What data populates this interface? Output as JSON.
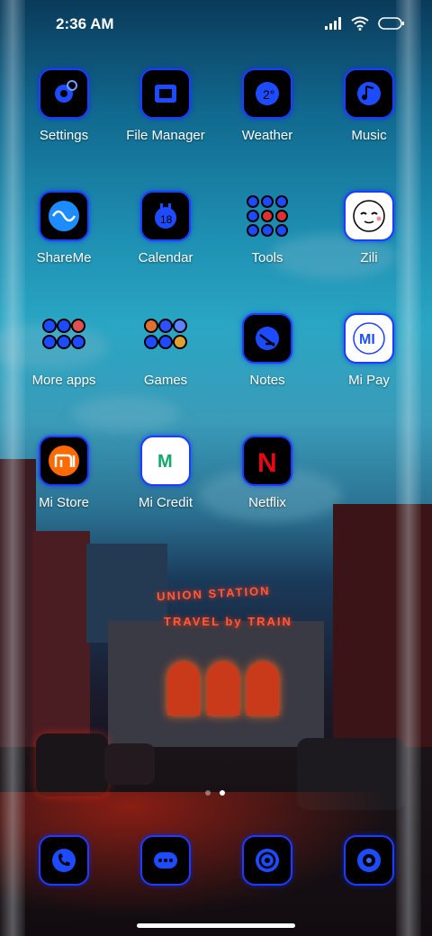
{
  "status_bar": {
    "time": "2:36 AM",
    "icons": [
      "signal-icon",
      "wifi-icon",
      "battery-icon"
    ]
  },
  "apps": [
    {
      "label": "Settings",
      "icon": "settings-icon"
    },
    {
      "label": "File Manager",
      "icon": "file-manager-icon"
    },
    {
      "label": "Weather",
      "icon": "weather-icon"
    },
    {
      "label": "Music",
      "icon": "music-icon"
    },
    {
      "label": "ShareMe",
      "icon": "shareme-icon"
    },
    {
      "label": "Calendar",
      "icon": "calendar-icon"
    },
    {
      "label": "Tools",
      "icon": "tools-folder-icon"
    },
    {
      "label": "Zili",
      "icon": "zili-icon"
    },
    {
      "label": "More apps",
      "icon": "more-apps-folder-icon"
    },
    {
      "label": "Games",
      "icon": "games-folder-icon"
    },
    {
      "label": "Notes",
      "icon": "notes-icon"
    },
    {
      "label": "Mi Pay",
      "icon": "mi-pay-icon",
      "glyph": "MI"
    },
    {
      "label": "Mi Store",
      "icon": "mi-store-icon"
    },
    {
      "label": "Mi Credit",
      "icon": "mi-credit-icon",
      "glyph": "M"
    },
    {
      "label": "Netflix",
      "icon": "netflix-icon",
      "glyph": "N"
    }
  ],
  "page_indicator": {
    "pages": 2,
    "current": 2
  },
  "dock": [
    {
      "icon": "phone-icon"
    },
    {
      "icon": "messaging-icon"
    },
    {
      "icon": "browser-icon"
    },
    {
      "icon": "camera-icon"
    }
  ],
  "wallpaper": {
    "sign_top": "UNION STATION",
    "sign_bottom": "TRAVEL by TRAIN"
  },
  "colors": {
    "icon_accent": "#1d3cff",
    "mi_orange": "#ff6a00",
    "netflix_red": "#e50914",
    "mi_credit_green": "#12a86a"
  }
}
